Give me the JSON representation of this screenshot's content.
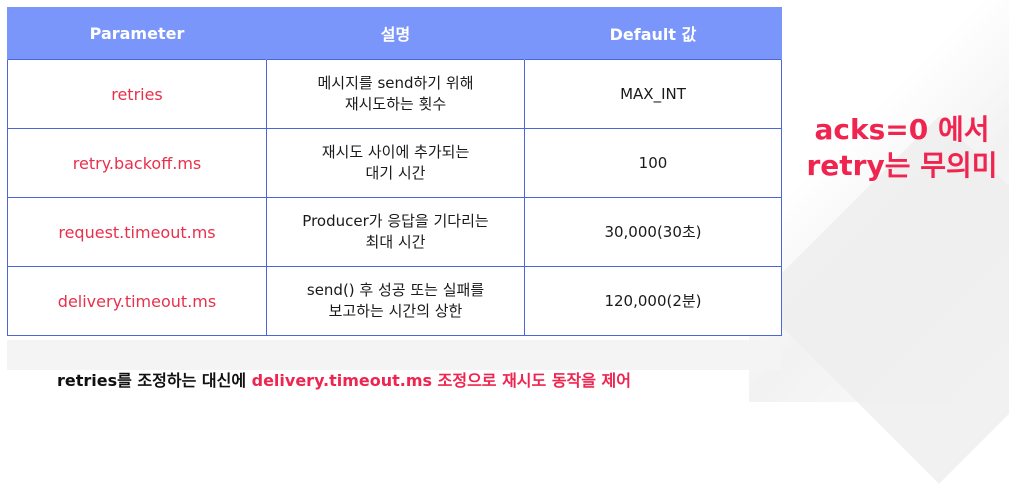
{
  "table": {
    "headers": [
      "Parameter",
      "설명",
      "Default 값"
    ],
    "rows": [
      {
        "param": "retries",
        "desc": [
          "메시지를 send하기 위해",
          "재시도하는 횟수"
        ],
        "default": "MAX_INT"
      },
      {
        "param": "retry.backoff.ms",
        "desc": [
          "재시도 사이에 추가되는",
          "대기 시간"
        ],
        "default": "100"
      },
      {
        "param": "request.timeout.ms",
        "desc": [
          "Producer가 응답을 기다리는",
          "최대 시간"
        ],
        "default": "30,000(30초)"
      },
      {
        "param": "delivery.timeout.ms",
        "desc": [
          "send() 후 성공 또는 실패를",
          "보고하는 시간의 상한"
        ],
        "default": "120,000(2분)"
      }
    ]
  },
  "side_note": {
    "line1": "acks=0 에서",
    "line2": "retry는 무의미"
  },
  "footer": {
    "part1": "retries를 조정하는 대신에 ",
    "part2": "delivery.timeout.ms 조정으로 재시도 동작을 제어"
  },
  "colors": {
    "header_bg": "#7b96fa",
    "accent_red": "#ef2550",
    "border": "#4a66d8"
  }
}
